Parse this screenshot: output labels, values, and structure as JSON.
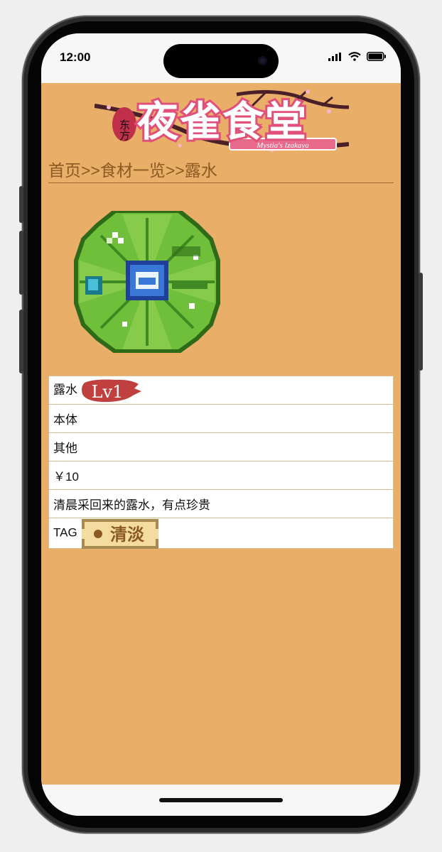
{
  "status_bar": {
    "time": "12:00"
  },
  "header": {
    "logo_main": "夜雀食堂",
    "logo_seal": "东方",
    "logo_sub": "Mystia's Izakaya"
  },
  "breadcrumb": {
    "home": "首页",
    "sep1": ">>",
    "list": "食材一览",
    "sep2": ">>",
    "current": "露水"
  },
  "ingredient": {
    "name": "露水",
    "level_badge": "Lv1",
    "origin": "本体",
    "category": "其他",
    "price": "￥10",
    "description": "清晨采回来的露水，有点珍贵",
    "tag_label": "TAG",
    "tag": "清淡"
  },
  "colors": {
    "page_bg": "#e9ae68",
    "breadcrumb_text": "#8a5a22",
    "level_badge": "#c0403f",
    "tag_border": "#a8894f",
    "tag_text": "#8a5a22"
  }
}
